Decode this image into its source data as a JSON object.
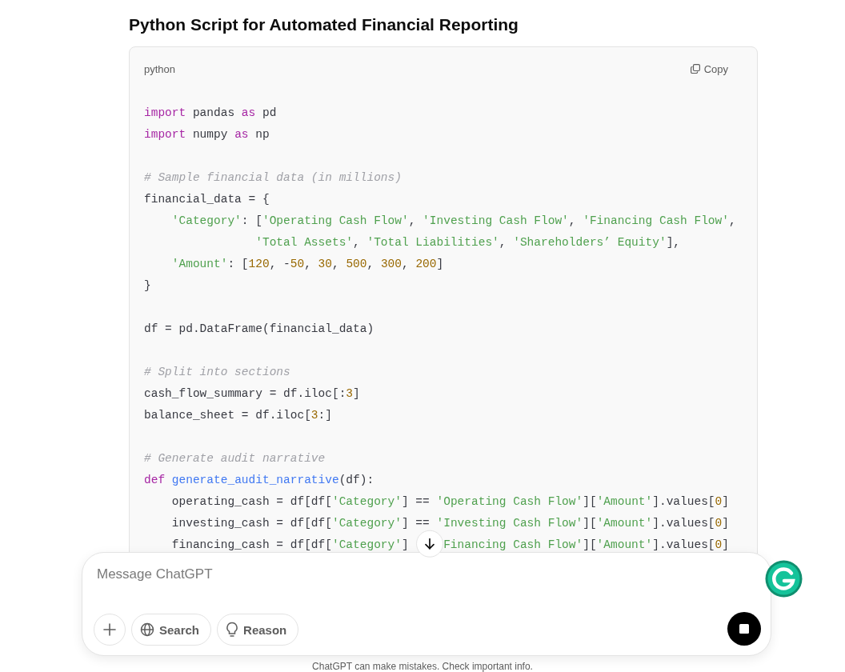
{
  "title": "Python Script for Automated Financial Reporting",
  "code_block": {
    "language": "python",
    "copy_label": "Copy",
    "lines": [
      {
        "kind": "code",
        "tokens": [
          {
            "kind": "keyword",
            "text": "import"
          },
          {
            "kind": "plain",
            "text": " pandas "
          },
          {
            "kind": "keyword",
            "text": "as"
          },
          {
            "kind": "plain",
            "text": " pd"
          }
        ]
      },
      {
        "kind": "code",
        "tokens": [
          {
            "kind": "keyword",
            "text": "import"
          },
          {
            "kind": "plain",
            "text": " numpy "
          },
          {
            "kind": "keyword",
            "text": "as"
          },
          {
            "kind": "plain",
            "text": " np"
          }
        ]
      },
      {
        "kind": "blank"
      },
      {
        "kind": "code",
        "tokens": [
          {
            "kind": "comment",
            "text": "# Sample financial data (in millions)"
          }
        ]
      },
      {
        "kind": "code",
        "tokens": [
          {
            "kind": "plain",
            "text": "financial_data = {"
          }
        ]
      },
      {
        "kind": "code",
        "tokens": [
          {
            "kind": "string",
            "text": "    'Category'"
          },
          {
            "kind": "plain",
            "text": ": ["
          },
          {
            "kind": "string",
            "text": "'Operating Cash Flow'"
          },
          {
            "kind": "plain",
            "text": ", "
          },
          {
            "kind": "string",
            "text": "'Investing Cash Flow'"
          },
          {
            "kind": "plain",
            "text": ", "
          },
          {
            "kind": "string",
            "text": "'Financing Cash Flow'"
          },
          {
            "kind": "plain",
            "text": ","
          }
        ]
      },
      {
        "kind": "code",
        "tokens": [
          {
            "kind": "string",
            "text": "                'Total Assets'"
          },
          {
            "kind": "plain",
            "text": ", "
          },
          {
            "kind": "string",
            "text": "'Total Liabilities'"
          },
          {
            "kind": "plain",
            "text": ", "
          },
          {
            "kind": "string",
            "text": "'Shareholders’ Equity'"
          },
          {
            "kind": "plain",
            "text": "],"
          }
        ]
      },
      {
        "kind": "code",
        "tokens": [
          {
            "kind": "string",
            "text": "    'Amount'"
          },
          {
            "kind": "plain",
            "text": ": ["
          },
          {
            "kind": "number",
            "text": "120"
          },
          {
            "kind": "plain",
            "text": ", -"
          },
          {
            "kind": "number",
            "text": "50"
          },
          {
            "kind": "plain",
            "text": ", "
          },
          {
            "kind": "number",
            "text": "30"
          },
          {
            "kind": "plain",
            "text": ", "
          },
          {
            "kind": "number",
            "text": "500"
          },
          {
            "kind": "plain",
            "text": ", "
          },
          {
            "kind": "number",
            "text": "300"
          },
          {
            "kind": "plain",
            "text": ", "
          },
          {
            "kind": "number",
            "text": "200"
          },
          {
            "kind": "plain",
            "text": "]"
          }
        ]
      },
      {
        "kind": "code",
        "tokens": [
          {
            "kind": "plain",
            "text": "}"
          }
        ]
      },
      {
        "kind": "blank"
      },
      {
        "kind": "code",
        "tokens": [
          {
            "kind": "plain",
            "text": "df = pd.DataFrame(financial_data)"
          }
        ]
      },
      {
        "kind": "blank"
      },
      {
        "kind": "code",
        "tokens": [
          {
            "kind": "comment",
            "text": "# Split into sections"
          }
        ]
      },
      {
        "kind": "code",
        "tokens": [
          {
            "kind": "plain",
            "text": "cash_flow_summary = df.iloc[:"
          },
          {
            "kind": "number",
            "text": "3"
          },
          {
            "kind": "plain",
            "text": "]"
          }
        ]
      },
      {
        "kind": "code",
        "tokens": [
          {
            "kind": "plain",
            "text": "balance_sheet = df.iloc["
          },
          {
            "kind": "number",
            "text": "3"
          },
          {
            "kind": "plain",
            "text": ":]"
          }
        ]
      },
      {
        "kind": "blank"
      },
      {
        "kind": "code",
        "tokens": [
          {
            "kind": "comment",
            "text": "# Generate audit narrative"
          }
        ]
      },
      {
        "kind": "code",
        "tokens": [
          {
            "kind": "keyword",
            "text": "def "
          },
          {
            "kind": "function",
            "text": "generate_audit_narrative"
          },
          {
            "kind": "plain",
            "text": "(df):"
          }
        ]
      },
      {
        "kind": "code",
        "tokens": [
          {
            "kind": "plain",
            "text": "    operating_cash = df[df["
          },
          {
            "kind": "string",
            "text": "'Category'"
          },
          {
            "kind": "plain",
            "text": "] == "
          },
          {
            "kind": "string",
            "text": "'Operating Cash Flow'"
          },
          {
            "kind": "plain",
            "text": "]["
          },
          {
            "kind": "string",
            "text": "'Amount'"
          },
          {
            "kind": "plain",
            "text": "].values["
          },
          {
            "kind": "number",
            "text": "0"
          },
          {
            "kind": "plain",
            "text": "]"
          }
        ]
      },
      {
        "kind": "code",
        "tokens": [
          {
            "kind": "plain",
            "text": "    investing_cash = df[df["
          },
          {
            "kind": "string",
            "text": "'Category'"
          },
          {
            "kind": "plain",
            "text": "] == "
          },
          {
            "kind": "string",
            "text": "'Investing Cash Flow'"
          },
          {
            "kind": "plain",
            "text": "]["
          },
          {
            "kind": "string",
            "text": "'Amount'"
          },
          {
            "kind": "plain",
            "text": "].values["
          },
          {
            "kind": "number",
            "text": "0"
          },
          {
            "kind": "plain",
            "text": "]"
          }
        ]
      },
      {
        "kind": "code",
        "tokens": [
          {
            "kind": "plain",
            "text": "    financing_cash = df[df["
          },
          {
            "kind": "string",
            "text": "'Category'"
          },
          {
            "kind": "plain",
            "text": "] "
          },
          {
            "kind": "covered"
          },
          {
            "kind": "string",
            "text": "Financing Cash Flow'"
          },
          {
            "kind": "plain",
            "text": "]["
          },
          {
            "kind": "string",
            "text": "'Amount'"
          },
          {
            "kind": "plain",
            "text": "].values["
          },
          {
            "kind": "number",
            "text": "0"
          },
          {
            "kind": "plain",
            "text": "]"
          }
        ]
      }
    ]
  },
  "composer": {
    "placeholder": "Message ChatGPT",
    "tools": [
      {
        "kind": "search",
        "label": "Search"
      },
      {
        "kind": "reason",
        "label": "Reason"
      }
    ]
  },
  "disclaimer": "ChatGPT can make mistakes. Check important info."
}
